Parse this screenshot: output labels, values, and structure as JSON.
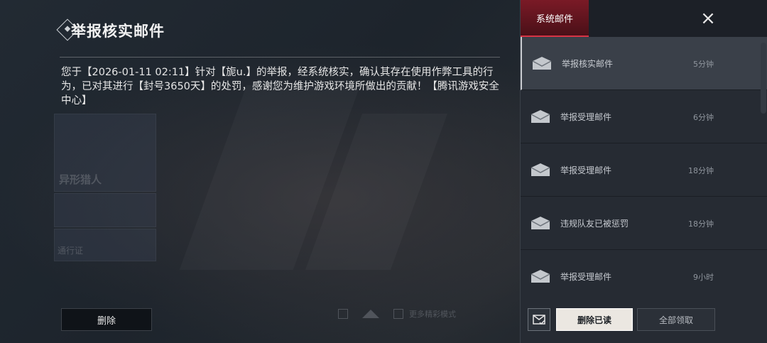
{
  "mail_detail": {
    "title": "举报核实邮件",
    "body": "您于【2026-01-11 02:11】针对【旎u.】的举报，经系统核实，确认其存在使用作弊工具的行为，已对其进行【封号3650天】的处罚，感谢您为维护游戏环境所做出的贡献！【腾讯游戏安全中心】",
    "delete_label": "删除"
  },
  "background": {
    "banner_1": "异形猎人",
    "banner_3": "通行证",
    "dock_text": "更多精彩模式"
  },
  "sidebar": {
    "tab_label": "系统邮件",
    "close_icon": "×",
    "items": [
      {
        "subject": "举报核实邮件",
        "time": "5分钟",
        "selected": true
      },
      {
        "subject": "举报受理邮件",
        "time": "6分钟",
        "selected": false
      },
      {
        "subject": "举报受理邮件",
        "time": "18分钟",
        "selected": false
      },
      {
        "subject": "违规队友已被惩罚",
        "time": "18分钟",
        "selected": false
      },
      {
        "subject": "举报受理邮件",
        "time": "9小时",
        "selected": false
      }
    ],
    "delete_read_label": "删除已读",
    "claim_all_label": "全部领取"
  },
  "colors": {
    "accent_red": "#d93344",
    "selected_bg": "#3a4049",
    "primary_button": "#ebe7e1"
  }
}
